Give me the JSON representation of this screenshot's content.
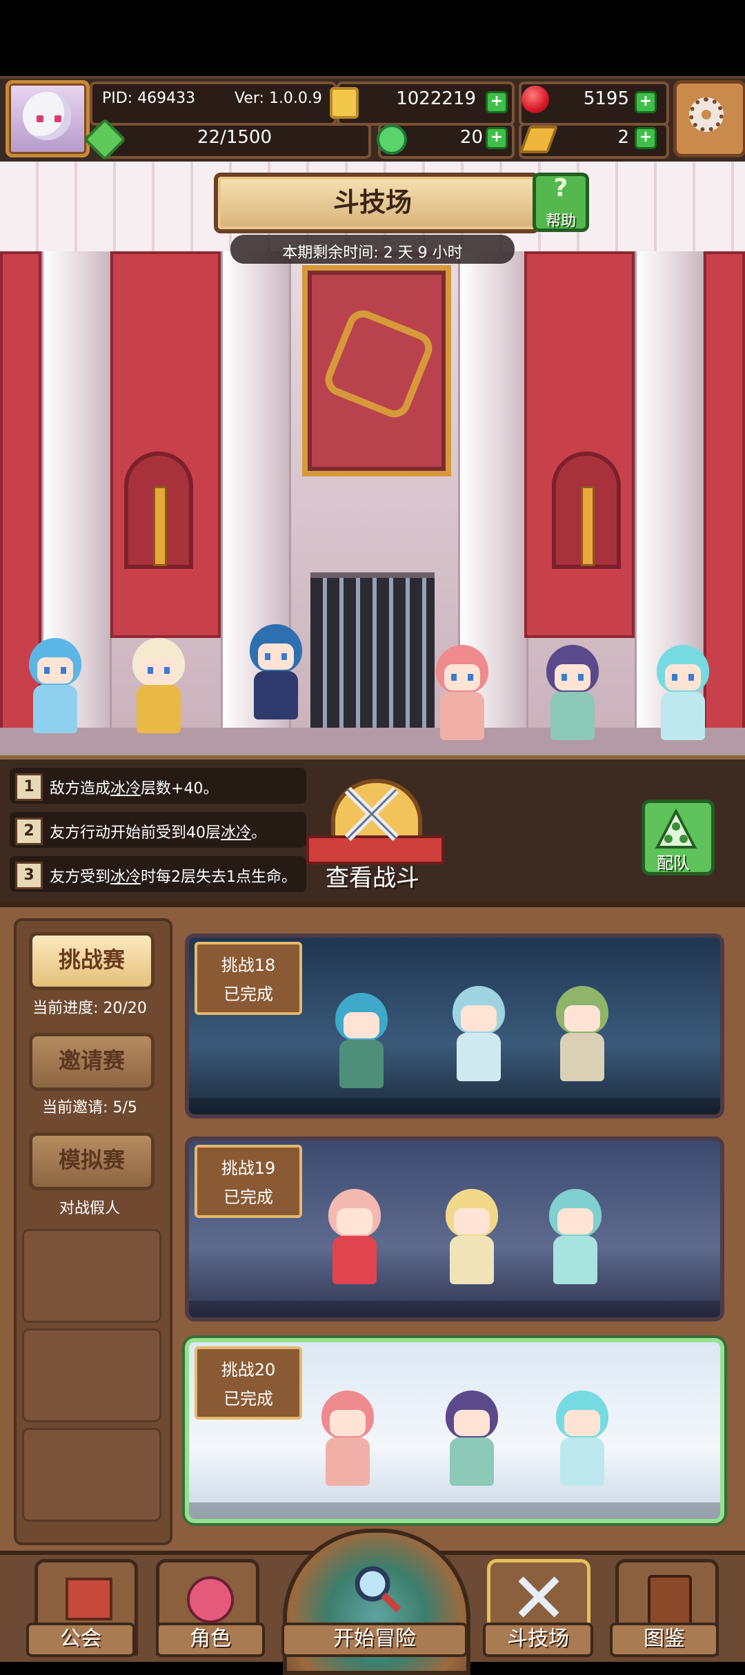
{
  "header": {
    "pid": "PID: 469433",
    "version": "Ver: 1.0.0.9",
    "gold": "1022219",
    "ruby": "5195",
    "stamina": "22/1500",
    "clover": "20",
    "ticket": "2",
    "plus_symbol": "+"
  },
  "arena": {
    "title": "斗技场",
    "help_label": "帮助",
    "help_symbol": "?",
    "timer": "本期剩余时间: 2 天 9 小时"
  },
  "rules": [
    {
      "num": "1",
      "before": "敌方造成",
      "keyword": "冰冷",
      "after": "层数+40。"
    },
    {
      "num": "2",
      "before": "友方行动开始前受到40层",
      "keyword": "冰冷",
      "after": "。"
    },
    {
      "num": "3",
      "before": "友方受到",
      "keyword": "冰冷",
      "after": "时每2层失去1点生命。"
    }
  ],
  "actions": {
    "view_battle": "查看战斗",
    "team": "配队"
  },
  "modes": [
    {
      "label": "挑战赛",
      "sub": "当前进度: 20/20",
      "active": true
    },
    {
      "label": "邀请赛",
      "sub": "当前邀请: 5/5",
      "active": false
    },
    {
      "label": "模拟赛",
      "sub": "对战假人",
      "active": false
    }
  ],
  "challenges": [
    {
      "title": "挑战18",
      "status": "已完成"
    },
    {
      "title": "挑战19",
      "status": "已完成"
    },
    {
      "title": "挑战20",
      "status": "已完成"
    }
  ],
  "nav": [
    {
      "label": "公会"
    },
    {
      "label": "角色"
    },
    {
      "label": "开始冒险"
    },
    {
      "label": "斗技场"
    },
    {
      "label": "图鉴"
    }
  ],
  "icons": {
    "avatar": "avatar-icon",
    "gold": "gold-coin-icon",
    "ruby": "ruby-icon",
    "stamina": "stamina-leaf-icon",
    "clover": "clover-icon",
    "ticket": "ticket-icon",
    "settings": "gear-icon",
    "help": "question-icon",
    "view_battle": "crossed-swords-icon",
    "team": "team-icon"
  },
  "colors": {
    "accent_green": "#3fbf49",
    "panel_brown": "#3d2b22",
    "selected_border": "#94e28f"
  }
}
